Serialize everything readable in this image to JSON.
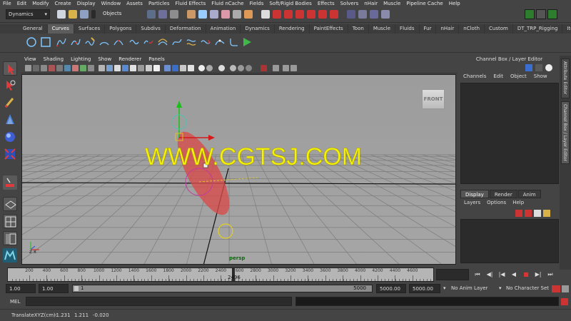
{
  "menu_bar": [
    "File",
    "Edit",
    "Modify",
    "Create",
    "Display",
    "Window",
    "Assets",
    "Particles",
    "Fluid Effects",
    "Fluid nCache",
    "Fields",
    "Soft/Rigid Bodies",
    "Effects",
    "Solvers",
    "nHair",
    "Muscle",
    "Pipeline Cache",
    "Help"
  ],
  "status_line": {
    "mode": "Dynamics",
    "selection_mask": "Objects"
  },
  "shelf": {
    "tabs": [
      "General",
      "Curves",
      "Surfaces",
      "Polygons",
      "Subdivs",
      "Deformation",
      "Animation",
      "Dynamics",
      "Rendering",
      "PaintEffects",
      "Toon",
      "Muscle",
      "Fluids",
      "Fur",
      "nHair",
      "nCloth",
      "Custom",
      "DT_TRP_Rigging",
      "Item"
    ],
    "active_tab": "Curves"
  },
  "panel": {
    "menus": [
      "View",
      "Shading",
      "Lighting",
      "Show",
      "Renderer",
      "Panels"
    ],
    "viewcube_label": "FRONT",
    "camera_name": "persp",
    "watermark": "WWW.CGTSJ.COM",
    "axis_label": "z x"
  },
  "channel_box": {
    "title": "Channel Box / Layer Editor",
    "menus": [
      "Channels",
      "Edit",
      "Object",
      "Show"
    ]
  },
  "side_tabs": [
    "Attribute Editor",
    "Channel Box / Layer Editor"
  ],
  "layer_editor": {
    "tabs": [
      "Display",
      "Render",
      "Anim"
    ],
    "active_tab": "Display",
    "menus": [
      "Layers",
      "Options",
      "Help"
    ]
  },
  "time_slider": {
    "ticks": [
      "200",
      "400",
      "600",
      "800",
      "1000",
      "1200",
      "1400",
      "1600",
      "1800",
      "2000",
      "2200",
      "2400",
      "2600",
      "2800",
      "3000",
      "3200",
      "3400",
      "3600",
      "3800",
      "4000",
      "4200",
      "4400",
      "4600"
    ],
    "current_frame": "2496"
  },
  "range_slider": {
    "anim_start": "1.00",
    "playback_start": "1.00",
    "range_start": "1",
    "range_end": "5000",
    "playback_end": "5000.00",
    "anim_end": "5000.00",
    "anim_layer": "No Anim Layer",
    "character_set": "No Character Set"
  },
  "command_line": {
    "label": "MEL"
  },
  "help_line": {
    "label": "TranslateXYZ(cm):",
    "x": "-1.231",
    "y": "1.211",
    "z": "-0.020"
  },
  "colors": {
    "viewport_bg": "#a1a1a1",
    "watermark": "#f6f20d",
    "selection": "#d94a4a",
    "manipulator_green": "#19c019",
    "manipulator_red": "#d41a1a"
  }
}
